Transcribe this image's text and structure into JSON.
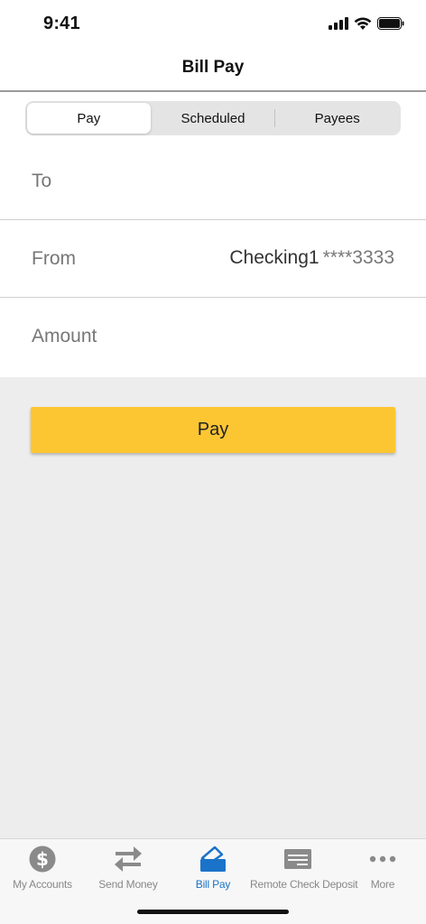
{
  "status": {
    "time": "9:41"
  },
  "header": {
    "title": "Bill Pay"
  },
  "segments": [
    {
      "label": "Pay",
      "active": true
    },
    {
      "label": "Scheduled",
      "active": false
    },
    {
      "label": "Payees",
      "active": false
    }
  ],
  "form": {
    "to_label": "To",
    "to_value": "",
    "from_label": "From",
    "from_account": "Checking1",
    "from_masked": "****3333",
    "amount_label": "Amount",
    "amount_value": ""
  },
  "actions": {
    "pay_label": "Pay"
  },
  "tabbar": {
    "items": [
      {
        "label": "My Accounts",
        "icon": "dollar-circle-icon"
      },
      {
        "label": "Send Money",
        "icon": "transfer-arrows-icon"
      },
      {
        "label": "Bill Pay",
        "icon": "bill-pay-icon"
      },
      {
        "label": "Remote Check Deposit",
        "icon": "check-card-icon"
      },
      {
        "label": "More",
        "icon": "more-dots-icon"
      }
    ],
    "active": "Bill Pay"
  },
  "colors": {
    "accent": "#1a73c9",
    "pay_button": "#fcc633",
    "background": "#ededed"
  }
}
